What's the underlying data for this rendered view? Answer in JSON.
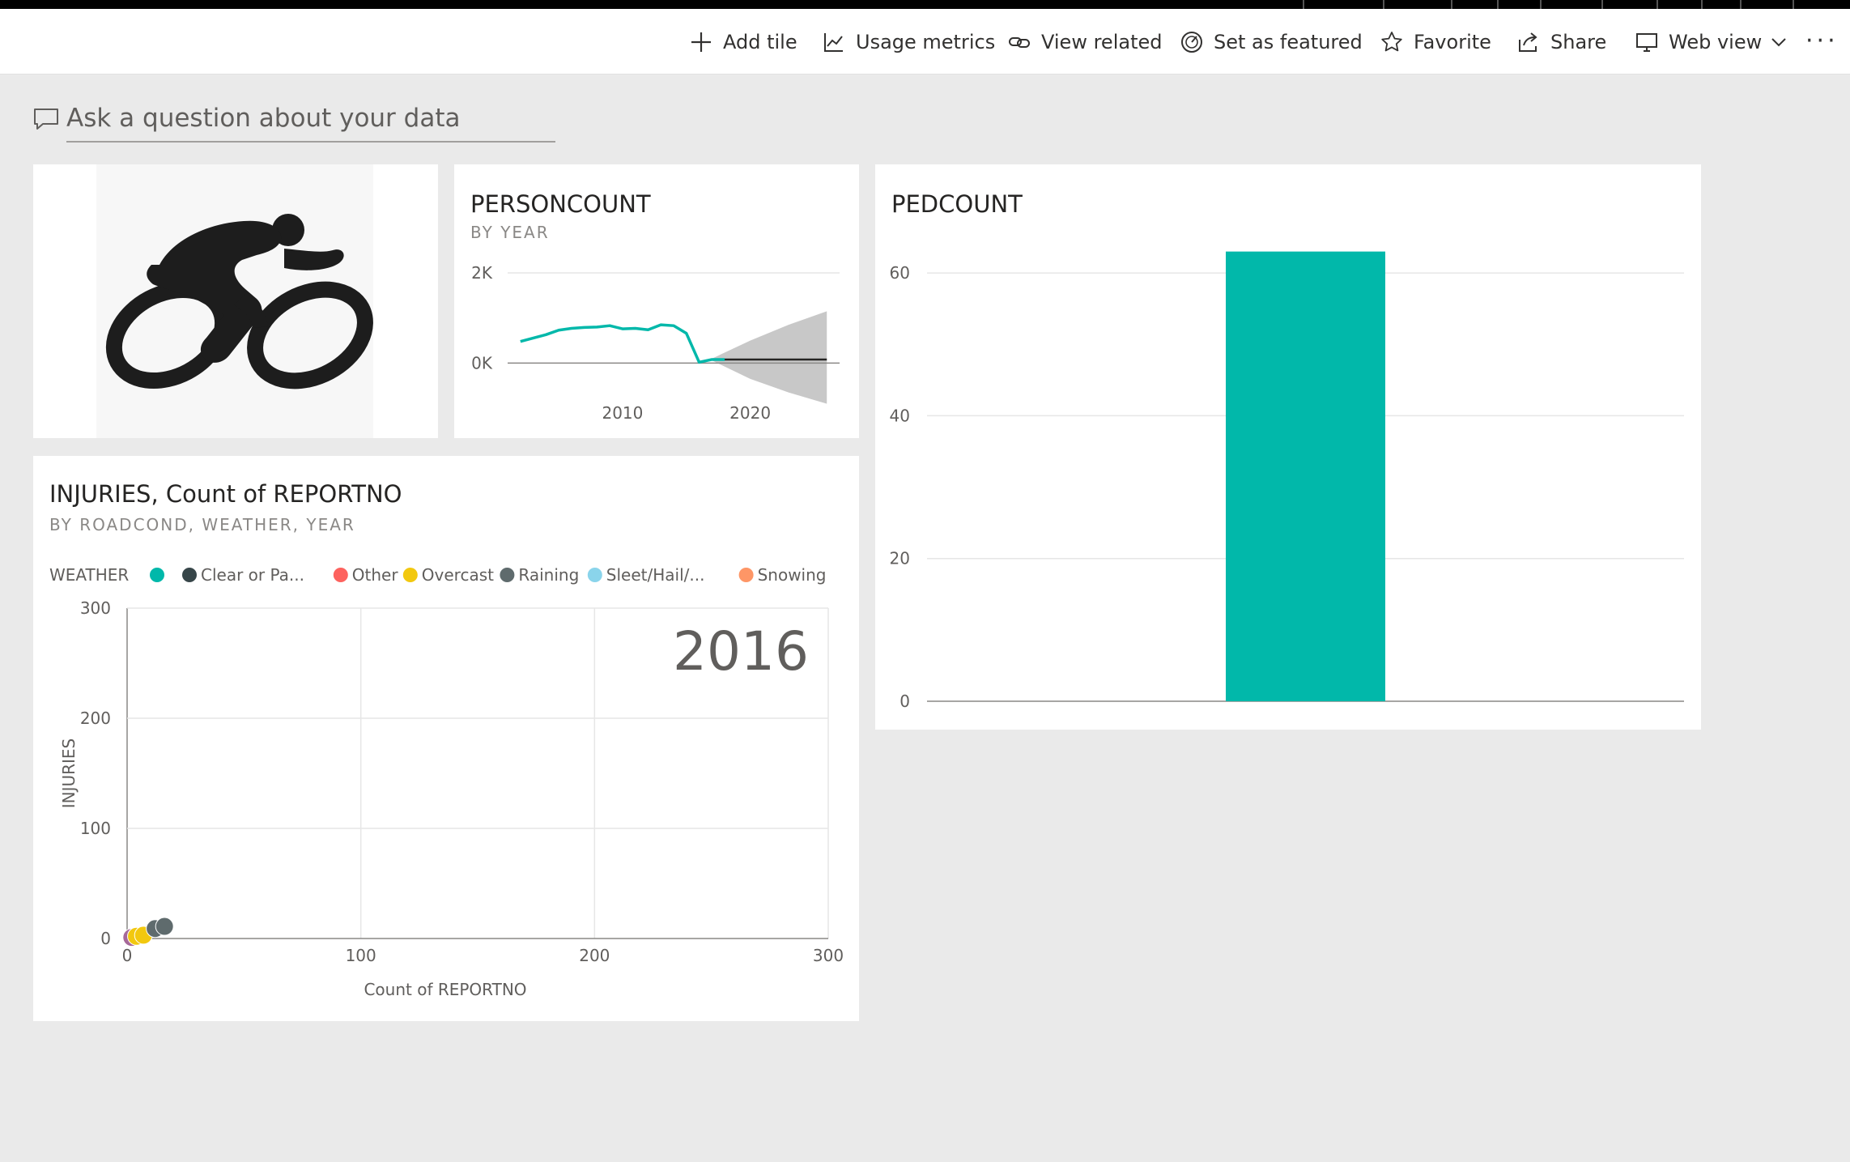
{
  "toolbar": {
    "add_tile": "Add tile",
    "usage_metrics": "Usage metrics",
    "view_related": "View related",
    "set_as_featured": "Set as featured",
    "favorite": "Favorite",
    "share": "Share",
    "web_view": "Web view",
    "more": "···"
  },
  "qna": {
    "placeholder": "Ask a question about your data"
  },
  "tiles": {
    "image": {
      "icon": "cyclist-icon"
    },
    "personcount": {
      "title": "PERSONCOUNT",
      "subtitle": "BY YEAR"
    },
    "pedcount": {
      "title": "PEDCOUNT"
    },
    "injuries": {
      "title": "INJURIES, Count of REPORTNO",
      "subtitle": "BY ROADCOND, WEATHER, YEAR"
    }
  },
  "chart_data": [
    {
      "id": "personcount",
      "type": "line",
      "title": "PERSONCOUNT",
      "subtitle": "BY YEAR",
      "y_ticks": [
        "2K",
        "0K"
      ],
      "x_ticks": [
        2010,
        2020
      ],
      "ylim": [
        -800,
        2000
      ],
      "xlim": [
        2001,
        2027
      ],
      "series": [
        {
          "color": "#01b8aa",
          "x": [
            2002,
            2004,
            2005,
            2006,
            2007,
            2008,
            2009,
            2010,
            2011,
            2012,
            2013,
            2014,
            2015,
            2016,
            2017,
            2018
          ],
          "y": [
            480,
            630,
            730,
            770,
            790,
            800,
            830,
            760,
            770,
            740,
            850,
            830,
            660,
            20,
            80,
            80
          ]
        }
      ],
      "forecast": {
        "line_color": "#252423",
        "band_color": "#c8c8c8",
        "x": [
          2017,
          2020,
          2023,
          2026
        ],
        "y": [
          80,
          80,
          80,
          80
        ],
        "upper": [
          100,
          500,
          850,
          1150
        ],
        "lower": [
          60,
          -350,
          -650,
          -900
        ]
      },
      "baseline": 0
    },
    {
      "id": "pedcount",
      "type": "bar",
      "title": "PEDCOUNT",
      "categories": [
        ""
      ],
      "values": [
        63
      ],
      "color": "#01b8aa",
      "y_ticks": [
        0,
        20,
        40,
        60
      ],
      "ylim": [
        0,
        65
      ]
    },
    {
      "id": "injuries",
      "type": "scatter",
      "title": "INJURIES, Count of REPORTNO",
      "subtitle": "BY ROADCOND, WEATHER, YEAR",
      "xlabel": "Count of REPORTNO",
      "ylabel": "INJURIES",
      "xlim": [
        0,
        300
      ],
      "ylim": [
        0,
        300
      ],
      "x_ticks": [
        0,
        100,
        200,
        300
      ],
      "y_ticks": [
        0,
        100,
        200,
        300
      ],
      "play_axis_value": "2016",
      "grid": true,
      "legend": {
        "title": "WEATHER",
        "entries": [
          {
            "label": "",
            "color": "#01b8aa"
          },
          {
            "label": "Clear or Pa...",
            "color": "#374649"
          },
          {
            "label": "Other",
            "color": "#fd625e"
          },
          {
            "label": "Overcast",
            "color": "#f2c80f"
          },
          {
            "label": "Raining",
            "color": "#5f6b6d"
          },
          {
            "label": "Sleet/Hail/...",
            "color": "#8ad4eb"
          },
          {
            "label": "Snowing",
            "color": "#fe9666"
          }
        ]
      },
      "points": [
        {
          "x": 2,
          "y": 1,
          "color": "#a66999"
        },
        {
          "x": 4,
          "y": 2,
          "color": "#f2c80f"
        },
        {
          "x": 7,
          "y": 3,
          "color": "#f2c80f"
        },
        {
          "x": 12,
          "y": 9,
          "color": "#5f6b6d"
        },
        {
          "x": 16,
          "y": 11,
          "color": "#5f6b6d"
        }
      ]
    }
  ]
}
